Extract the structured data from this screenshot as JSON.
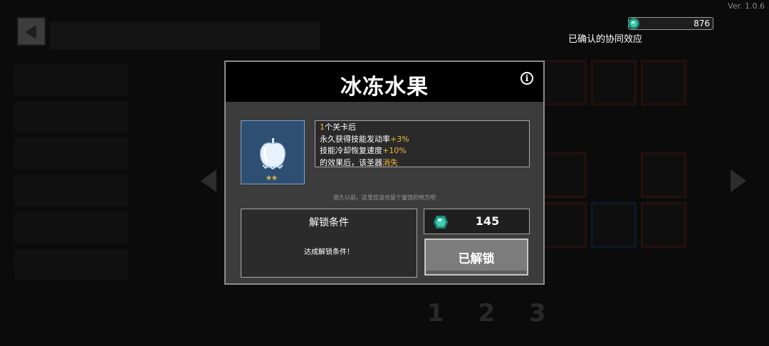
{
  "app": {
    "version": "Ver. 1.0.6"
  },
  "currency": {
    "gem_count": "876",
    "icon": "gem-icon"
  },
  "synergy": {
    "label": "已确认的协同效应"
  },
  "background": {
    "page_numbers": "1 2 3"
  },
  "modal": {
    "title": "冰冻水果",
    "item": {
      "icon": "frozen-apple-icon",
      "stars": "★★"
    },
    "description": {
      "line1_value": "1",
      "line1_text": "个关卡后",
      "line2_text": "永久获得技能发动率",
      "line2_value": "+3%",
      "line3_text": "技能冷却恢复速度",
      "line3_value": "+10%",
      "line4_text": "的效果后，该圣器",
      "line4_value": "消失"
    },
    "flavor_text": "很久以前，这里应该也是个富饶的地方吧",
    "unlock": {
      "title": "解锁条件",
      "condition": "达成解锁条件！"
    },
    "price": {
      "value": "145",
      "icon": "gem-icon"
    },
    "status_button": "已解锁"
  },
  "colors": {
    "highlight": "#f3b93a",
    "item_frame": "#2f4f72",
    "gem": "#3fd0b0"
  }
}
